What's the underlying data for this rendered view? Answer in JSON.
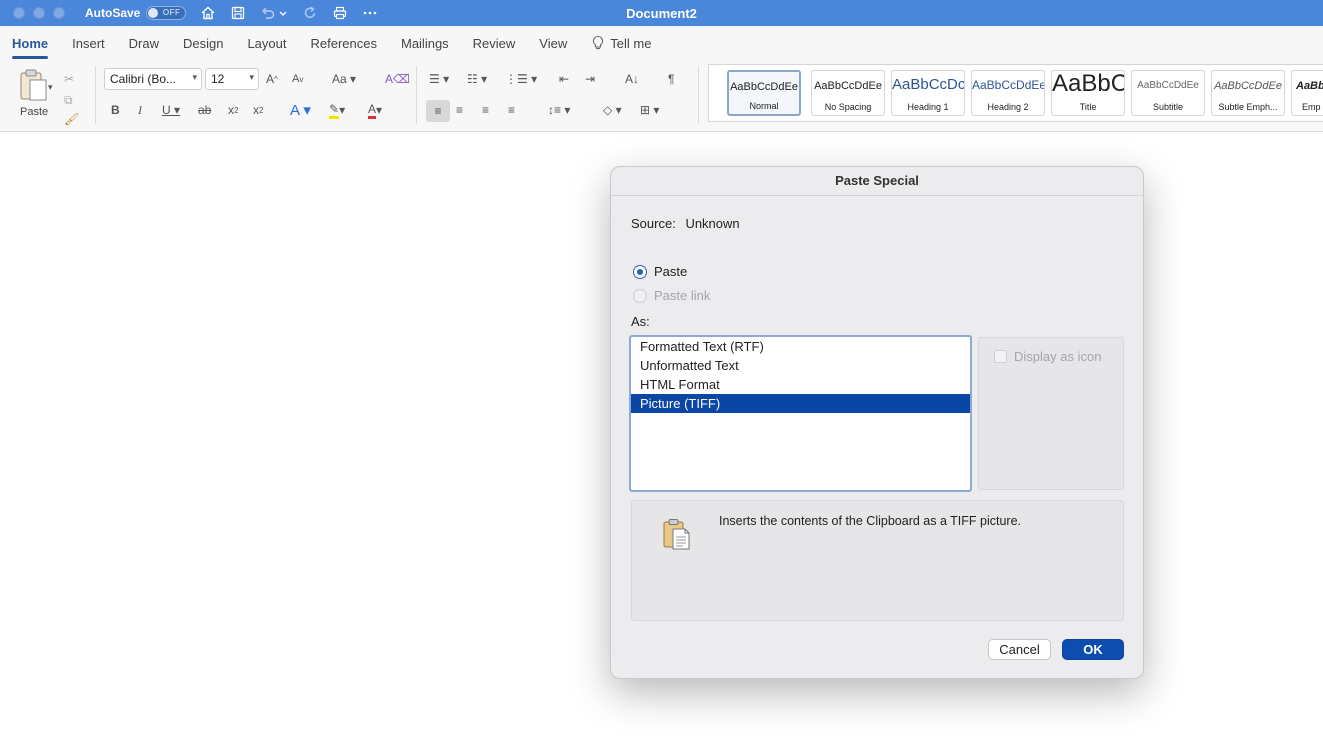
{
  "window": {
    "title": "Document2",
    "autosave_label": "AutoSave",
    "autosave_state": "OFF"
  },
  "ribbon": {
    "tabs": [
      "Home",
      "Insert",
      "Draw",
      "Design",
      "Layout",
      "References",
      "Mailings",
      "Review",
      "View"
    ],
    "active_tab": "Home",
    "tell_me": "Tell me",
    "paste_label": "Paste",
    "font_name": "Calibri (Bo...",
    "font_size": "12",
    "styles": [
      {
        "sample": "AaBbCcDdEe",
        "name": "Normal"
      },
      {
        "sample": "AaBbCcDdEe",
        "name": "No Spacing"
      },
      {
        "sample": "AaBbCcDc",
        "name": "Heading 1"
      },
      {
        "sample": "AaBbCcDdEe",
        "name": "Heading 2"
      },
      {
        "sample": "AaBbC",
        "name": "Title"
      },
      {
        "sample": "AaBbCcDdEe",
        "name": "Subtitle"
      },
      {
        "sample": "AaBbCcDdEe",
        "name": "Subtle Emph..."
      },
      {
        "sample": "AaBbC",
        "name": "Emp"
      }
    ]
  },
  "dialog": {
    "title": "Paste Special",
    "source_label": "Source:",
    "source_value": "Unknown",
    "paste_option": "Paste",
    "paste_link_option": "Paste link",
    "as_label": "As:",
    "formats": [
      "Formatted Text (RTF)",
      "Unformatted Text",
      "HTML Format",
      "Picture (TIFF)"
    ],
    "selected_format": "Picture (TIFF)",
    "display_as_icon": "Display as icon",
    "result_text": "Inserts the contents of the Clipboard as a TIFF picture.",
    "cancel_label": "Cancel",
    "ok_label": "OK",
    "accent_color": "#0a46a4"
  }
}
